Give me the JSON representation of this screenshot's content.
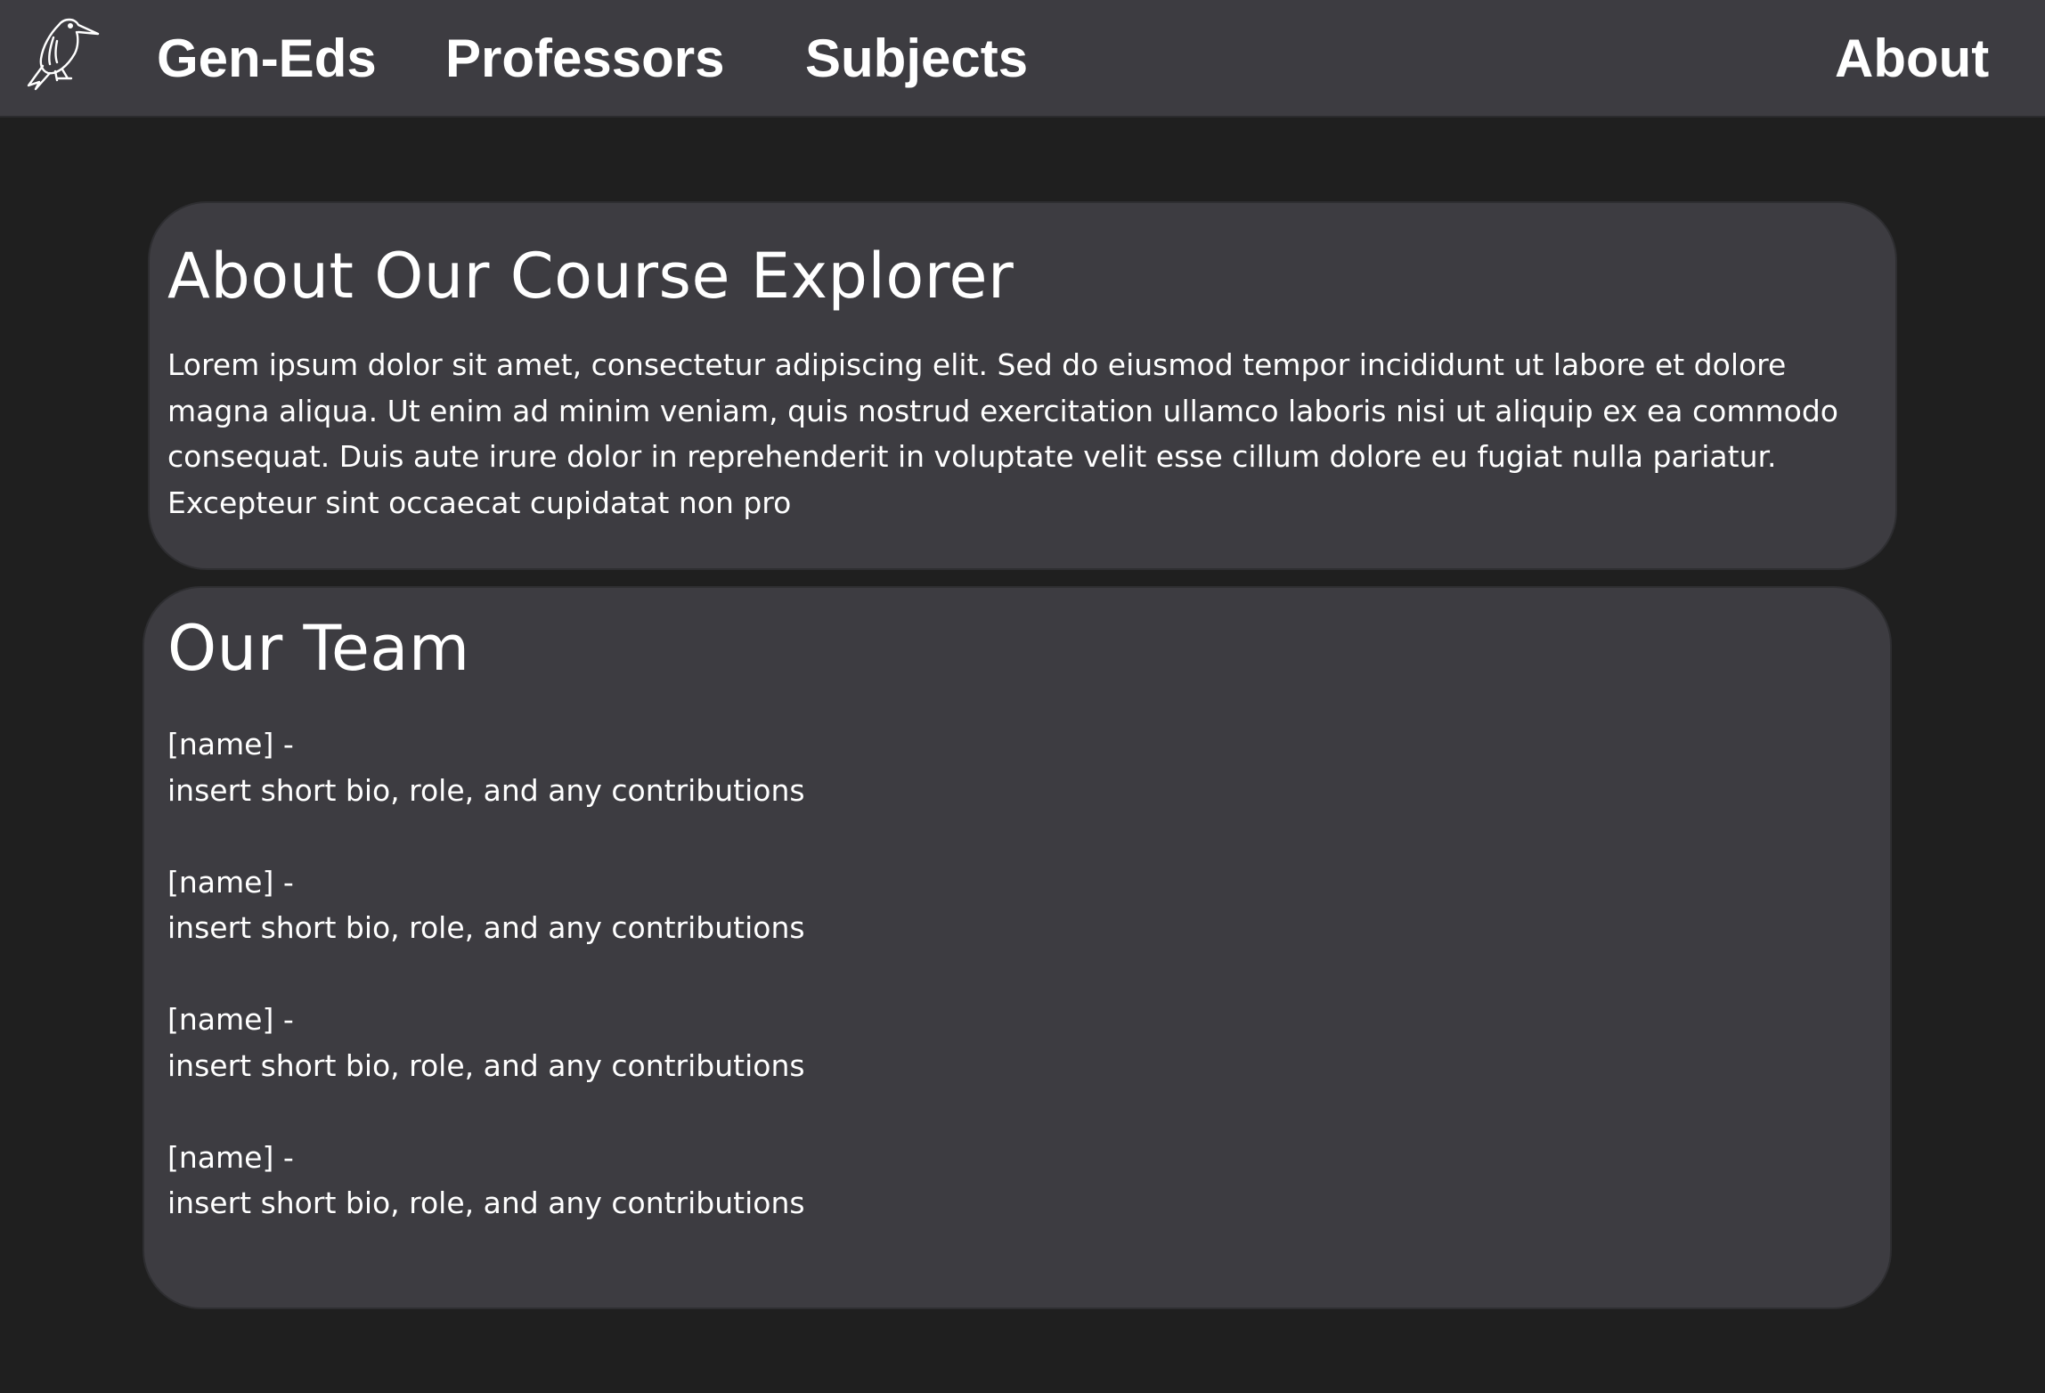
{
  "nav": {
    "logo": "kingfisher-logo",
    "links": [
      "Gen-Eds",
      "Professors",
      "Subjects"
    ],
    "about": "About"
  },
  "about_card": {
    "title": "About Our Course Explorer",
    "body": "Lorem ipsum dolor sit amet, consectetur adipiscing elit. Sed do eiusmod tempor incididunt ut labore et dolore magna aliqua. Ut enim ad minim veniam, quis nostrud exercitation ullamco laboris nisi ut aliquip ex ea commodo consequat. Duis aute irure dolor in reprehenderit in voluptate velit esse cillum dolore eu fugiat nulla pariatur. Excepteur sint occaecat cupidatat non pro"
  },
  "team_card": {
    "title": "Our Team",
    "members": [
      {
        "name": "[name] -",
        "bio": "insert short bio, role, and any contributions"
      },
      {
        "name": "[name] -",
        "bio": "insert short bio, role, and any contributions"
      },
      {
        "name": "[name] -",
        "bio": "insert short bio, role, and any contributions"
      },
      {
        "name": "[name] -",
        "bio": "insert short bio, role, and any contributions"
      }
    ]
  },
  "colors": {
    "background": "#1f1f1f",
    "navbar": "#3d3c41",
    "card": "#3d3c41",
    "text": "#ffffff"
  }
}
